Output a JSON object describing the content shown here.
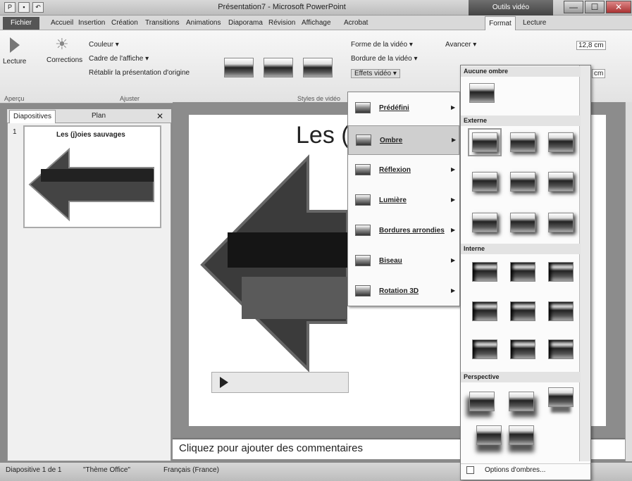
{
  "window": {
    "title": "Présentation7 - Microsoft PowerPoint",
    "context_tab": "Outils vidéo",
    "minimize": "—",
    "maximize": "☐",
    "close": "✕"
  },
  "qat": {
    "app": "P",
    "save": "▪",
    "undo": "↶"
  },
  "tabs": [
    "Fichier",
    "Accueil",
    "Insertion",
    "Création",
    "Transitions",
    "Animations",
    "Diaporama",
    "Révision",
    "Affichage",
    "Acrobat",
    "Format",
    "Lecture"
  ],
  "ribbon": {
    "play": "Lecture",
    "corrections": "Corrections",
    "couleur": "Couleur ▾",
    "cadre": "Cadre de l'affiche ▾",
    "retablir": "Rétablir la présentation d'origine",
    "forme": "Forme de la vidéo ▾",
    "bordure": "Bordure de la vidéo ▾",
    "effets": "Effets vidéo ▾",
    "avancer": "Avancer ▾",
    "size_h": "12,8 cm",
    "size_w": "cm",
    "groups": {
      "apercu": "Aperçu",
      "ajuster": "Ajuster",
      "styles": "Styles de vidéo"
    }
  },
  "panel": {
    "tab_diapos": "Diapositives",
    "tab_plan": "Plan",
    "close": "✕",
    "slide_num": "1",
    "thumb_title": "Les (j)oies sauvages"
  },
  "slide": {
    "title": "Les (j"
  },
  "notes": "Cliquez pour ajouter des commentaires",
  "status": {
    "slide": "Diapositive 1 de 1",
    "theme": "\"Thème Office\"",
    "lang": "Français (France)"
  },
  "menu": {
    "items": [
      "Prédéfini",
      "Ombre",
      "Réflexion",
      "Lumière",
      "Bordures arrondies",
      "Biseau",
      "Rotation 3D"
    ],
    "active": "Ombre"
  },
  "shadow_menu": {
    "none": "Aucune ombre",
    "externe": "Externe",
    "interne": "Interne",
    "perspective": "Perspective",
    "options": "Options d'ombres..."
  }
}
